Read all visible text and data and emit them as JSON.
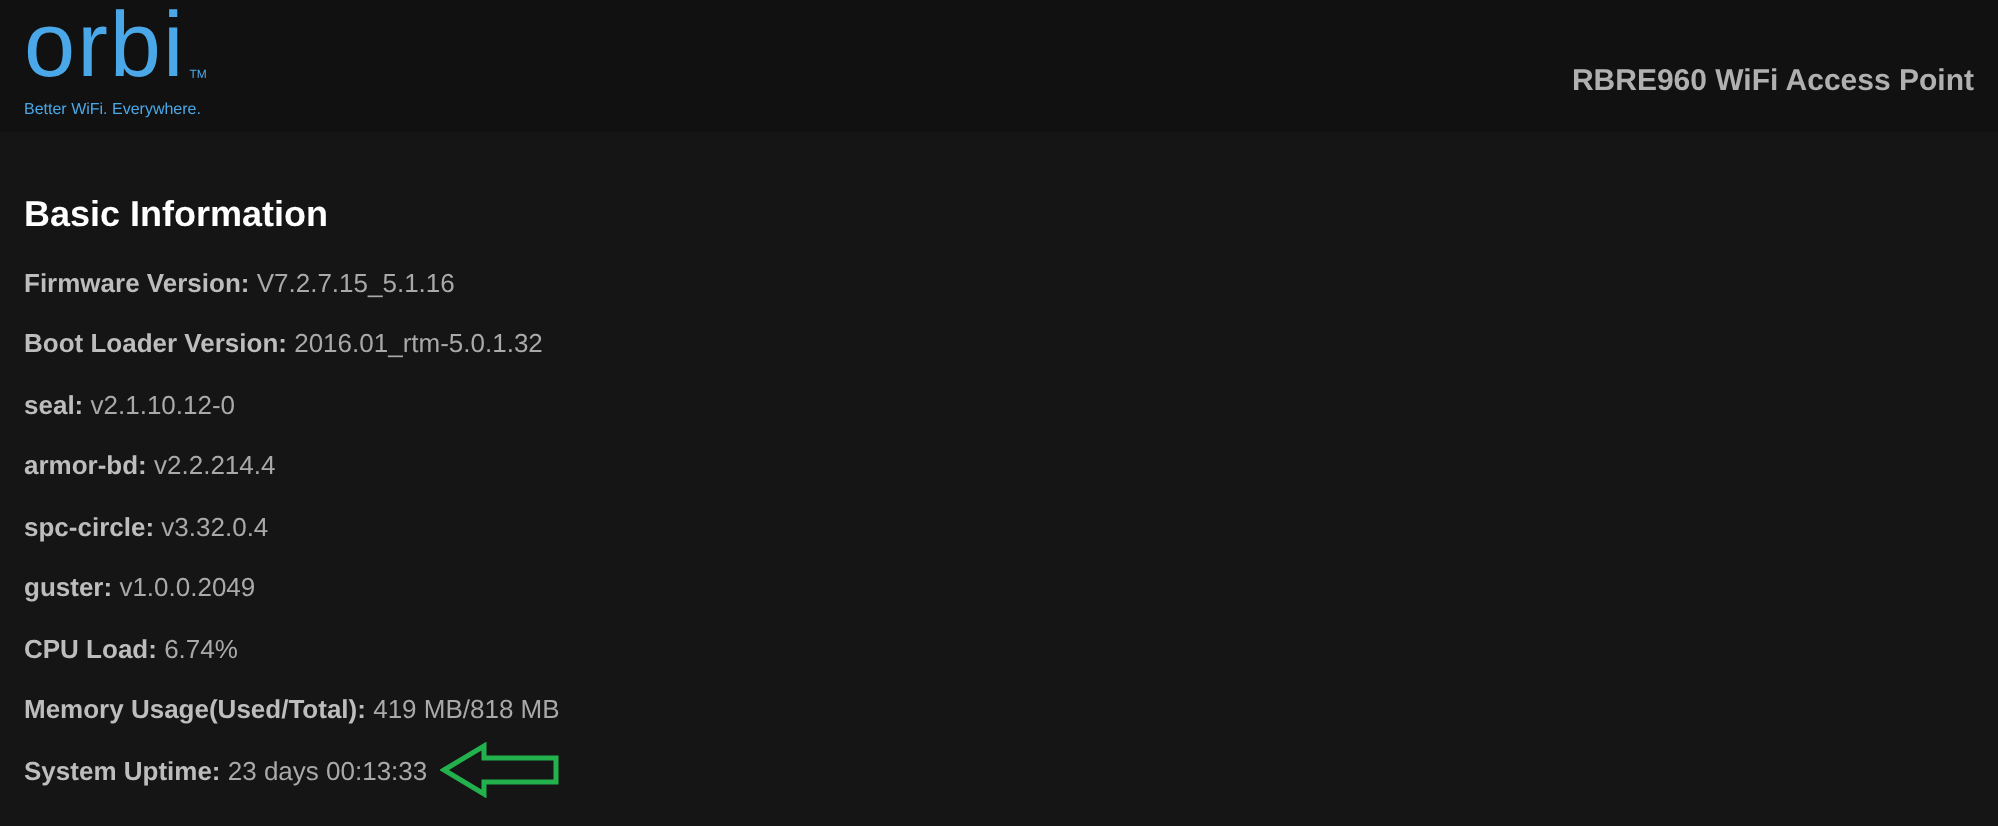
{
  "header": {
    "logo": {
      "wordmark": "orbi",
      "trademark": "TM",
      "tagline": "Better WiFi. Everywhere."
    },
    "device_title": "RBRE960 WiFi Access Point"
  },
  "section": {
    "title": "Basic Information",
    "rows": [
      {
        "label": "Firmware Version:",
        "value": "V7.2.7.15_5.1.16",
        "highlighted": false
      },
      {
        "label": "Boot Loader Version:",
        "value": "2016.01_rtm-5.0.1.32",
        "highlighted": false
      },
      {
        "label": "seal:",
        "value": "v2.1.10.12-0",
        "highlighted": false
      },
      {
        "label": "armor-bd:",
        "value": "v2.2.214.4",
        "highlighted": false
      },
      {
        "label": "spc-circle:",
        "value": "v3.32.0.4",
        "highlighted": false
      },
      {
        "label": "guster:",
        "value": "v1.0.0.2049",
        "highlighted": false
      },
      {
        "label": "CPU Load:",
        "value": "6.74%",
        "highlighted": false
      },
      {
        "label": "Memory Usage(Used/Total):",
        "value": "419 MB/818 MB",
        "highlighted": false
      },
      {
        "label": "System Uptime:",
        "value": "23 days 00:13:33",
        "highlighted": true
      }
    ]
  }
}
